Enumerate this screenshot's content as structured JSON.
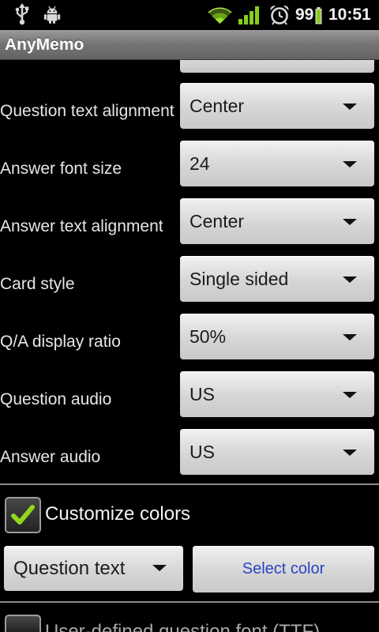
{
  "status_bar": {
    "icons": [
      "usb-icon",
      "android-debug-icon",
      "wifi-icon",
      "signal-icon",
      "alarm-icon",
      "battery-icon"
    ],
    "battery_level": "99",
    "time": "10:51"
  },
  "title_bar": {
    "title": "AnyMemo"
  },
  "settings": [
    {
      "label": "Question text alignment",
      "value": "Center"
    },
    {
      "label": "Answer font size",
      "value": "24"
    },
    {
      "label": "Answer text alignment",
      "value": "Center"
    },
    {
      "label": "Card style",
      "value": "Single sided"
    },
    {
      "label": "Q/A display ratio",
      "value": "50%"
    },
    {
      "label": "Question audio",
      "value": "US"
    },
    {
      "label": "Answer audio",
      "value": "US"
    }
  ],
  "customize_colors": {
    "label": "Customize colors",
    "checked": true
  },
  "color_picker": {
    "target_value": "Question text",
    "select_label": "Select color"
  },
  "user_font": {
    "label": "User-defined question font (TTF)",
    "checked": false
  },
  "colors": {
    "check": "#8fd61c",
    "link_blue": "#2a44c4",
    "status_green": "#86cf1a"
  }
}
